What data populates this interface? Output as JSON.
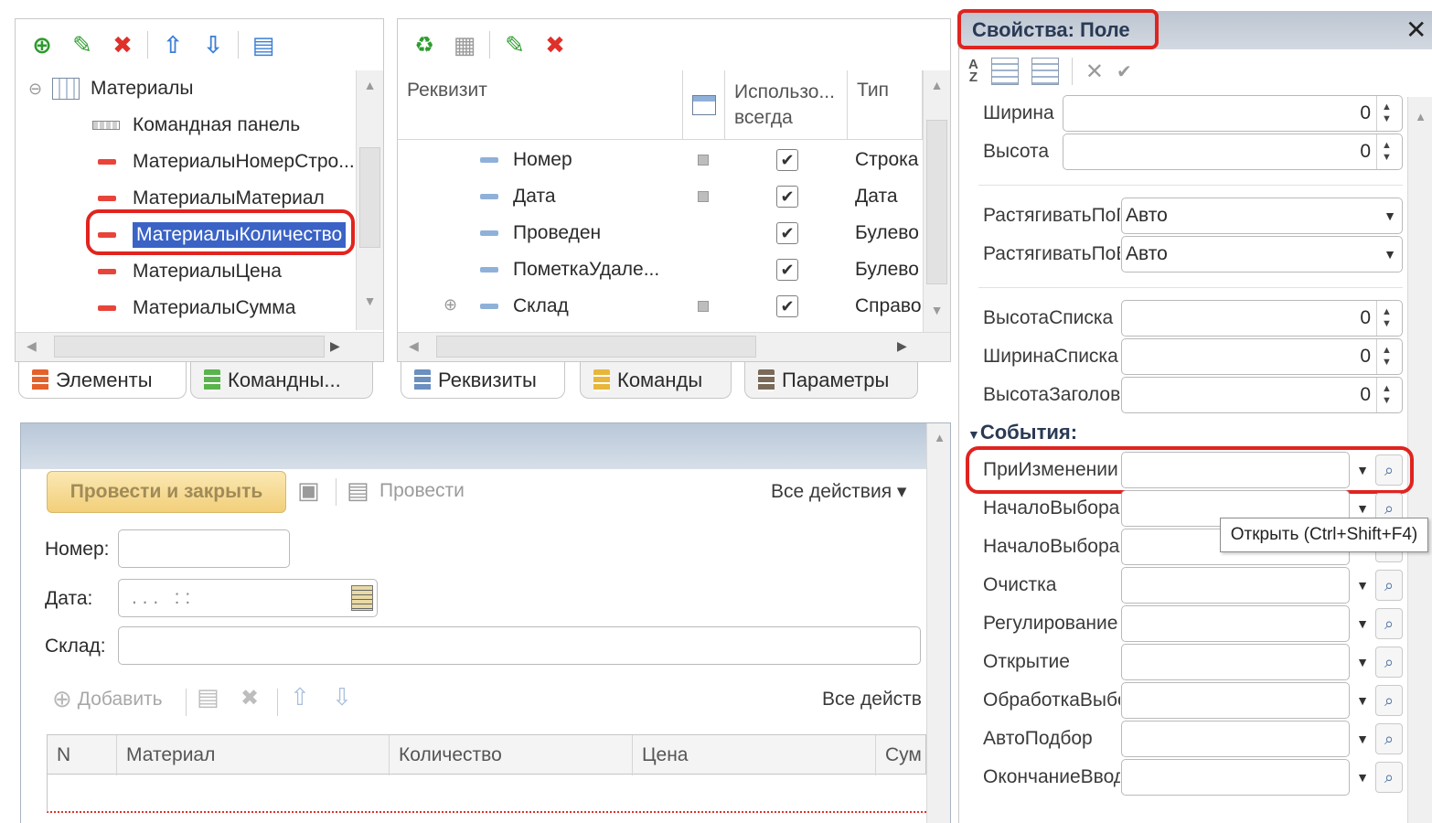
{
  "elements_panel": {
    "tree": [
      {
        "label": "Материалы",
        "kind": "table"
      },
      {
        "label": "Командная панель",
        "kind": "command-panel"
      },
      {
        "label": "МатериалыНомерСтро...",
        "kind": "field"
      },
      {
        "label": "МатериалыМатериал",
        "kind": "field"
      },
      {
        "label": "МатериалыКоличество",
        "kind": "field",
        "selected": true
      },
      {
        "label": "МатериалыЦена",
        "kind": "field"
      },
      {
        "label": "МатериалыСумма",
        "kind": "field"
      }
    ],
    "tabs": [
      "Элементы",
      "Командны..."
    ]
  },
  "attributes_panel": {
    "headers": {
      "attribute": "Реквизит",
      "use_always": "Использо... всегда",
      "type": "Тип"
    },
    "rows": [
      {
        "name": "Номер",
        "checked": true,
        "type": "Строка"
      },
      {
        "name": "Дата",
        "checked": true,
        "type": "Дата"
      },
      {
        "name": "Проведен",
        "checked": true,
        "type": "Булево"
      },
      {
        "name": "ПометкаУдале...",
        "checked": true,
        "type": "Булево"
      },
      {
        "name": "Склад",
        "checked": true,
        "type": "Справо",
        "expandable": true
      }
    ],
    "tabs": [
      "Реквизиты",
      "Команды",
      "Параметры"
    ]
  },
  "form_preview": {
    "post_close_label": "Провести и закрыть",
    "post_label": "Провести",
    "all_actions_label": "Все действия ▾",
    "number_label": "Номер:",
    "date_label": "Дата:",
    "date_placeholder": ". . .   : :",
    "warehouse_label": "Склад:",
    "add_label": "Добавить",
    "all_actions_short": "Все действ",
    "table_headers": [
      "N",
      "Материал",
      "Количество",
      "Цена",
      "Сум"
    ]
  },
  "properties": {
    "title": "Свойства: Поле",
    "rows": [
      {
        "label": "Ширина",
        "value": "0",
        "kind": "spin"
      },
      {
        "label": "Высота",
        "value": "0",
        "kind": "spin"
      },
      {
        "label": "РастягиватьПоГоризонтали",
        "value": "Авто",
        "kind": "select"
      },
      {
        "label": "РастягиватьПоВертикали",
        "value": "Авто",
        "kind": "select"
      },
      {
        "label": "ВысотаСписка",
        "value": "0",
        "kind": "spin"
      },
      {
        "label": "ШиринаСписка",
        "value": "0",
        "kind": "spin"
      },
      {
        "label": "ВысотаЗаголовка",
        "value": "0",
        "kind": "spin"
      }
    ],
    "events_header": "События:",
    "events": [
      {
        "label": "ПриИзменении",
        "value": ""
      },
      {
        "label": "НачалоВыбора",
        "value": ""
      },
      {
        "label": "НачалоВыбораИзСписка",
        "value": ""
      },
      {
        "label": "Очистка",
        "value": ""
      },
      {
        "label": "Регулирование",
        "value": ""
      },
      {
        "label": "Открытие",
        "value": ""
      },
      {
        "label": "ОбработкаВыбора",
        "value": ""
      },
      {
        "label": "АвтоПодбор",
        "value": ""
      },
      {
        "label": "ОкончаниеВвода",
        "value": ""
      }
    ],
    "tooltip": "Открыть (Ctrl+Shift+F4)"
  }
}
